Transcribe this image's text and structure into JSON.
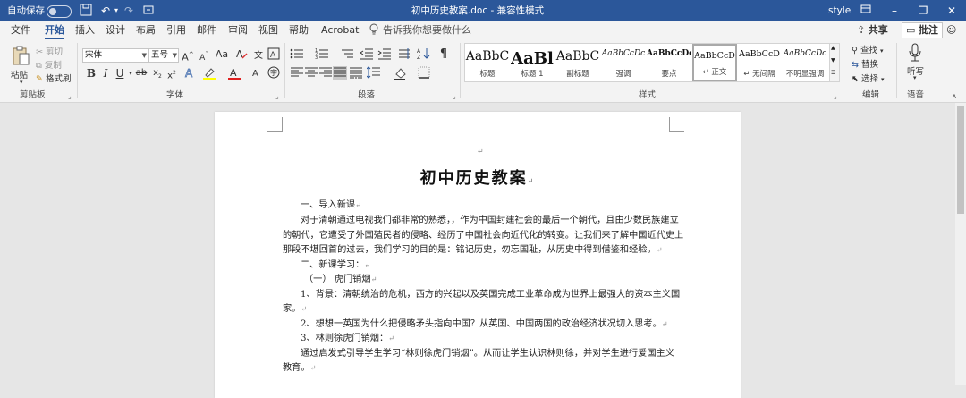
{
  "titlebar": {
    "autosave_label": "自动保存",
    "autosave_state": "关",
    "doc_title": "初中历史教案.doc  -  兼容性模式",
    "style_label": "style",
    "icons": [
      "save-icon",
      "undo-icon",
      "redo-icon",
      "customize-icon"
    ],
    "window_controls": [
      "ribbon-display-icon",
      "minimize-icon",
      "restore-icon",
      "close-icon"
    ]
  },
  "tabs": [
    "文件",
    "开始",
    "插入",
    "设计",
    "布局",
    "引用",
    "邮件",
    "审阅",
    "视图",
    "帮助",
    "Acrobat"
  ],
  "active_tab": "开始",
  "tell_me": "告诉我你想要做什么",
  "share_label": "共享",
  "comments_label": "批注",
  "clipboard": {
    "paste": "粘贴",
    "cut": "剪切",
    "copy": "复制",
    "format_painter": "格式刷",
    "group": "剪贴板"
  },
  "font": {
    "name": "宋体",
    "size": "五号",
    "group": "字体"
  },
  "paragraph": {
    "group": "段落"
  },
  "styles": {
    "group": "样式",
    "items": [
      {
        "sample": "AaBbC",
        "name": "标题",
        "size": "14px",
        "weight": "normal",
        "italic": false
      },
      {
        "sample": "AaBl",
        "name": "标题 1",
        "size": "18px",
        "weight": "bold",
        "italic": false
      },
      {
        "sample": "AaBbC",
        "name": "副标题",
        "size": "14px",
        "weight": "normal",
        "italic": false
      },
      {
        "sample": "AaBbCcDc",
        "name": "强调",
        "size": "9px",
        "weight": "normal",
        "italic": true
      },
      {
        "sample": "AaBbCcDc",
        "name": "要点",
        "size": "9px",
        "weight": "bold",
        "italic": false
      },
      {
        "sample": "AaBbCcD",
        "name": "↵ 正文",
        "size": "9.5px",
        "weight": "normal",
        "italic": false
      },
      {
        "sample": "AaBbCcD",
        "name": "↵ 无间隔",
        "size": "9.5px",
        "weight": "normal",
        "italic": false
      },
      {
        "sample": "AaBbCcDc",
        "name": "不明显强调",
        "size": "9px",
        "weight": "normal",
        "italic": true
      }
    ]
  },
  "editing": {
    "find": "查找",
    "replace": "替换",
    "select": "选择",
    "group": "编辑"
  },
  "voice": {
    "dictate": "听写",
    "group": "语音"
  },
  "document": {
    "title": "初中历史教案",
    "lines": [
      "一、导入新课",
      "对于清朝通过电视我们都非常的熟悉，，作为中国封建社会的最后一个朝代，且由少数民族建立",
      "的朝代，它遭受了外国殖民者的侵略、经历了中国社会向近代化的转变。让我们来了解中国近代史上",
      "那段不堪回首的过去，我们学习的目的是：铭记历史，勿忘国耻，从历史中得到借鉴和经验。",
      "二、新课学习：",
      "（一）    虎门销烟",
      "1、背景：清朝统治的危机，西方的兴起以及英国完成工业革命成为世界上最强大的资本主义国",
      "家。",
      "2、想想一英国为什么把侵略矛头指向中国？从英国、中国两国的政治经济状况切入思考。",
      "3、林则徐虎门销烟：",
      "通过启发式引导学生学习“林则徐虎门销烟”。从而让学生认识林则徐，并对学生进行爱国主义",
      "教育。"
    ]
  }
}
